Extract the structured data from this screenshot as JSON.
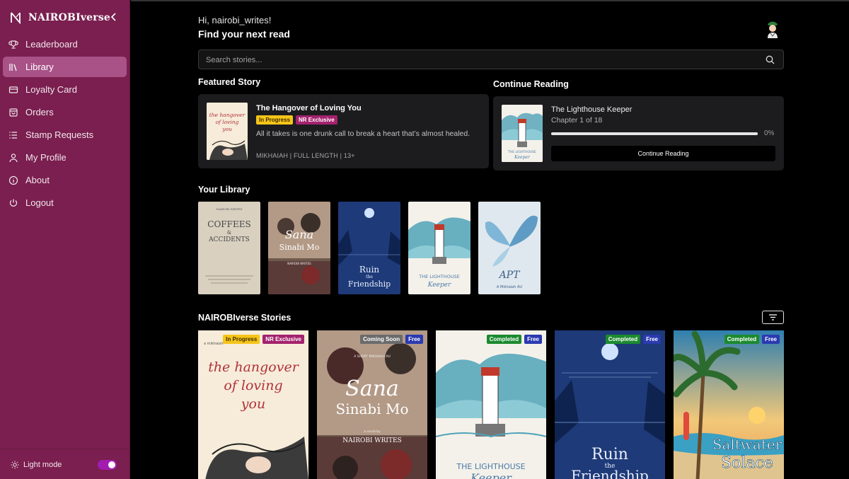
{
  "brand": {
    "name": "NAIROBIverse"
  },
  "sidebar": {
    "items": [
      {
        "label": "Leaderboard",
        "icon": "trophy-icon"
      },
      {
        "label": "Library",
        "icon": "library-icon",
        "active": true
      },
      {
        "label": "Loyalty Card",
        "icon": "card-icon"
      },
      {
        "label": "Orders",
        "icon": "bag-icon"
      },
      {
        "label": "Stamp Requests",
        "icon": "list-icon"
      },
      {
        "label": "My Profile",
        "icon": "user-icon"
      },
      {
        "label": "About",
        "icon": "info-icon"
      },
      {
        "label": "Logout",
        "icon": "power-icon"
      }
    ],
    "light_mode_label": "Light mode",
    "light_mode_on": true
  },
  "header": {
    "greeting": "Hi, nairobi_writes!",
    "headline": "Find your next read"
  },
  "search": {
    "placeholder": "Search stories..."
  },
  "featured": {
    "section_title": "Featured Story",
    "title": "The Hangover of Loving You",
    "badges": [
      "In Progress",
      "NR Exclusive"
    ],
    "description": "All it takes is one drunk call to break a heart that’s almost healed.",
    "meta": "MIKHAIAH | FULL LENGTH | 13+",
    "cover_text": [
      "the hangover",
      "of loving",
      "you"
    ]
  },
  "continue_reading": {
    "section_title": "Continue Reading",
    "title": "The Lighthouse Keeper",
    "chapter": "Chapter 1 of 18",
    "progress_percent": 0,
    "progress_label": "0%",
    "button_label": "Continue Reading",
    "cover_text": [
      "THE LIGHTHOUSE",
      "Keeper"
    ]
  },
  "library": {
    "section_title": "Your Library",
    "books": [
      {
        "cover_text": [
          "NAIROBI WRITES",
          "COFFEES",
          "&",
          "ACCIDENTS"
        ]
      },
      {
        "cover_text": [
          "Sana",
          "Sinabi Mo",
          "NAIROBI WRITES"
        ]
      },
      {
        "cover_text": [
          "Ruin",
          "the",
          "Friendship"
        ]
      },
      {
        "cover_text": [
          "THE LIGHTHOUSE",
          "Keeper"
        ]
      },
      {
        "cover_text": [
          "APT",
          "A Mikhaiah AU"
        ]
      }
    ]
  },
  "stories": {
    "section_title": "NAIROBIverse Stories",
    "items": [
      {
        "badges": [
          "In Progress",
          "NR Exclusive"
        ],
        "badge_types": [
          "progress",
          "exclusive"
        ],
        "cover_text": [
          "a mikhaiah",
          "the hangover",
          "of loving",
          "you"
        ]
      },
      {
        "badges": [
          "Coming Soon",
          "Free"
        ],
        "badge_types": [
          "coming",
          "free"
        ],
        "cover_text": [
          "A SHORT MIKHAIAH AU",
          "Sana",
          "Sinabi Mo",
          "a novel by",
          "NAIROBI WRITES"
        ]
      },
      {
        "badges": [
          "Completed",
          "Free"
        ],
        "badge_types": [
          "complete",
          "free"
        ],
        "cover_text": [
          "THE LIGHTHOUSE",
          "Keeper"
        ]
      },
      {
        "badges": [
          "Completed",
          "Free"
        ],
        "badge_types": [
          "complete",
          "free"
        ],
        "cover_text": [
          "Ruin",
          "the",
          "Friendship"
        ]
      },
      {
        "badges": [
          "Completed",
          "Free"
        ],
        "badge_types": [
          "complete",
          "free"
        ],
        "cover_text": [
          "Saltwater",
          "Solace"
        ]
      }
    ]
  },
  "colors": {
    "sidebar_bg": "#7a1f4f",
    "sidebar_active": "#a85287",
    "card_bg": "#1c1c1e",
    "badge_in_progress": "#f5c518",
    "badge_exclusive": "#a3226d",
    "badge_completed": "#1b8a2f",
    "badge_free": "#2a3ab0",
    "toggle_on": "#a21caf"
  }
}
